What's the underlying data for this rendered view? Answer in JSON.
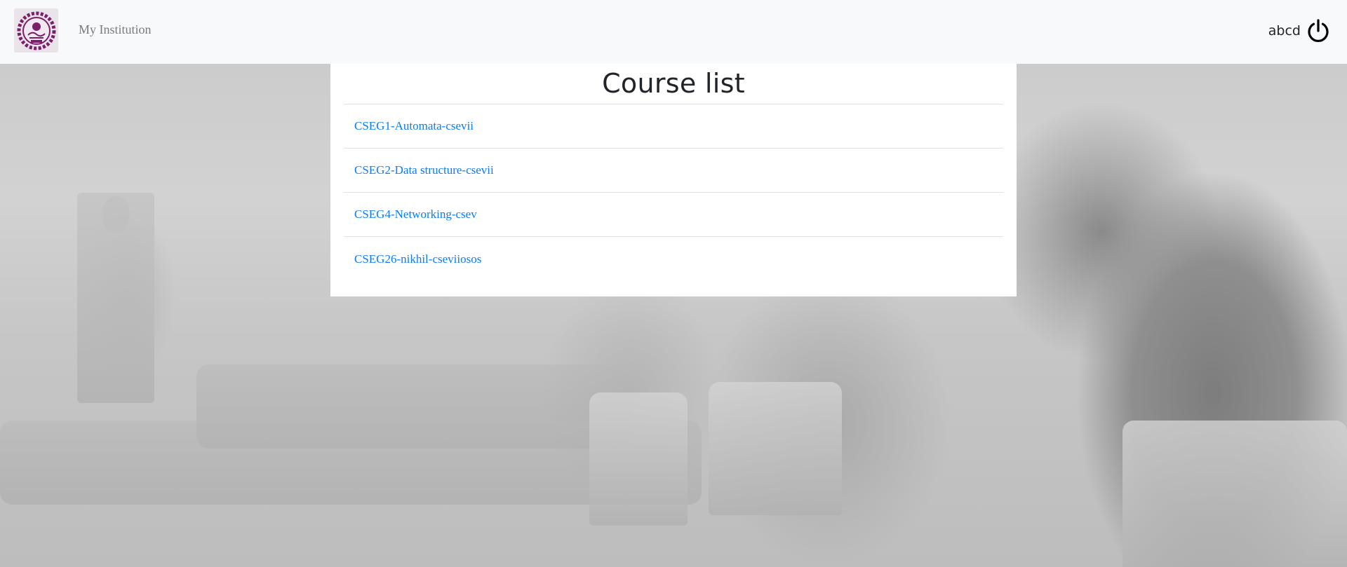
{
  "navbar": {
    "brand": "My Institution",
    "username": "abcd",
    "logout_icon": "power-icon",
    "logo_icon": "institution-seal-logo"
  },
  "main": {
    "title": "Course list",
    "courses": [
      {
        "label": "CSEG1-Automata-csevii"
      },
      {
        "label": "CSEG2-Data structure-csevii"
      },
      {
        "label": "CSEG4-Networking-csev"
      },
      {
        "label": "CSEG26-nikhil-cseviiosos"
      }
    ]
  },
  "colors": {
    "navbar_bg": "#f8f9fa",
    "link": "#0a7bff",
    "logo_primary": "#7b1f6a"
  }
}
